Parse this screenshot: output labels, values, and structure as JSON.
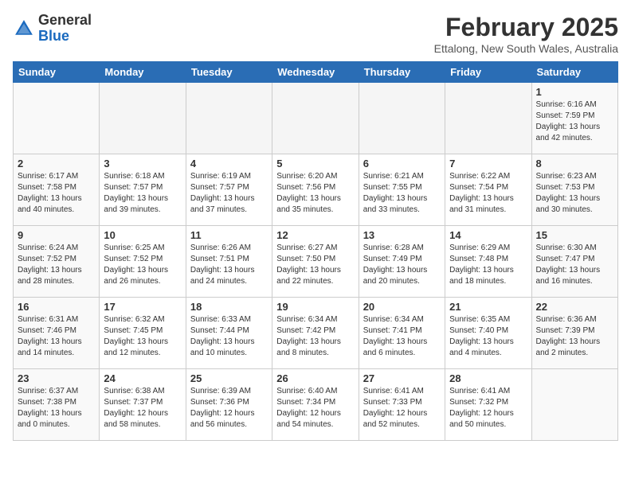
{
  "logo": {
    "general": "General",
    "blue": "Blue"
  },
  "title": "February 2025",
  "subtitle": "Ettalong, New South Wales, Australia",
  "days_of_week": [
    "Sunday",
    "Monday",
    "Tuesday",
    "Wednesday",
    "Thursday",
    "Friday",
    "Saturday"
  ],
  "weeks": [
    [
      {
        "day": "",
        "info": ""
      },
      {
        "day": "",
        "info": ""
      },
      {
        "day": "",
        "info": ""
      },
      {
        "day": "",
        "info": ""
      },
      {
        "day": "",
        "info": ""
      },
      {
        "day": "",
        "info": ""
      },
      {
        "day": "1",
        "info": "Sunrise: 6:16 AM\nSunset: 7:59 PM\nDaylight: 13 hours\nand 42 minutes."
      }
    ],
    [
      {
        "day": "2",
        "info": "Sunrise: 6:17 AM\nSunset: 7:58 PM\nDaylight: 13 hours\nand 40 minutes."
      },
      {
        "day": "3",
        "info": "Sunrise: 6:18 AM\nSunset: 7:57 PM\nDaylight: 13 hours\nand 39 minutes."
      },
      {
        "day": "4",
        "info": "Sunrise: 6:19 AM\nSunset: 7:57 PM\nDaylight: 13 hours\nand 37 minutes."
      },
      {
        "day": "5",
        "info": "Sunrise: 6:20 AM\nSunset: 7:56 PM\nDaylight: 13 hours\nand 35 minutes."
      },
      {
        "day": "6",
        "info": "Sunrise: 6:21 AM\nSunset: 7:55 PM\nDaylight: 13 hours\nand 33 minutes."
      },
      {
        "day": "7",
        "info": "Sunrise: 6:22 AM\nSunset: 7:54 PM\nDaylight: 13 hours\nand 31 minutes."
      },
      {
        "day": "8",
        "info": "Sunrise: 6:23 AM\nSunset: 7:53 PM\nDaylight: 13 hours\nand 30 minutes."
      }
    ],
    [
      {
        "day": "9",
        "info": "Sunrise: 6:24 AM\nSunset: 7:52 PM\nDaylight: 13 hours\nand 28 minutes."
      },
      {
        "day": "10",
        "info": "Sunrise: 6:25 AM\nSunset: 7:52 PM\nDaylight: 13 hours\nand 26 minutes."
      },
      {
        "day": "11",
        "info": "Sunrise: 6:26 AM\nSunset: 7:51 PM\nDaylight: 13 hours\nand 24 minutes."
      },
      {
        "day": "12",
        "info": "Sunrise: 6:27 AM\nSunset: 7:50 PM\nDaylight: 13 hours\nand 22 minutes."
      },
      {
        "day": "13",
        "info": "Sunrise: 6:28 AM\nSunset: 7:49 PM\nDaylight: 13 hours\nand 20 minutes."
      },
      {
        "day": "14",
        "info": "Sunrise: 6:29 AM\nSunset: 7:48 PM\nDaylight: 13 hours\nand 18 minutes."
      },
      {
        "day": "15",
        "info": "Sunrise: 6:30 AM\nSunset: 7:47 PM\nDaylight: 13 hours\nand 16 minutes."
      }
    ],
    [
      {
        "day": "16",
        "info": "Sunrise: 6:31 AM\nSunset: 7:46 PM\nDaylight: 13 hours\nand 14 minutes."
      },
      {
        "day": "17",
        "info": "Sunrise: 6:32 AM\nSunset: 7:45 PM\nDaylight: 13 hours\nand 12 minutes."
      },
      {
        "day": "18",
        "info": "Sunrise: 6:33 AM\nSunset: 7:44 PM\nDaylight: 13 hours\nand 10 minutes."
      },
      {
        "day": "19",
        "info": "Sunrise: 6:34 AM\nSunset: 7:42 PM\nDaylight: 13 hours\nand 8 minutes."
      },
      {
        "day": "20",
        "info": "Sunrise: 6:34 AM\nSunset: 7:41 PM\nDaylight: 13 hours\nand 6 minutes."
      },
      {
        "day": "21",
        "info": "Sunrise: 6:35 AM\nSunset: 7:40 PM\nDaylight: 13 hours\nand 4 minutes."
      },
      {
        "day": "22",
        "info": "Sunrise: 6:36 AM\nSunset: 7:39 PM\nDaylight: 13 hours\nand 2 minutes."
      }
    ],
    [
      {
        "day": "23",
        "info": "Sunrise: 6:37 AM\nSunset: 7:38 PM\nDaylight: 13 hours\nand 0 minutes."
      },
      {
        "day": "24",
        "info": "Sunrise: 6:38 AM\nSunset: 7:37 PM\nDaylight: 12 hours\nand 58 minutes."
      },
      {
        "day": "25",
        "info": "Sunrise: 6:39 AM\nSunset: 7:36 PM\nDaylight: 12 hours\nand 56 minutes."
      },
      {
        "day": "26",
        "info": "Sunrise: 6:40 AM\nSunset: 7:34 PM\nDaylight: 12 hours\nand 54 minutes."
      },
      {
        "day": "27",
        "info": "Sunrise: 6:41 AM\nSunset: 7:33 PM\nDaylight: 12 hours\nand 52 minutes."
      },
      {
        "day": "28",
        "info": "Sunrise: 6:41 AM\nSunset: 7:32 PM\nDaylight: 12 hours\nand 50 minutes."
      },
      {
        "day": "",
        "info": ""
      }
    ]
  ]
}
